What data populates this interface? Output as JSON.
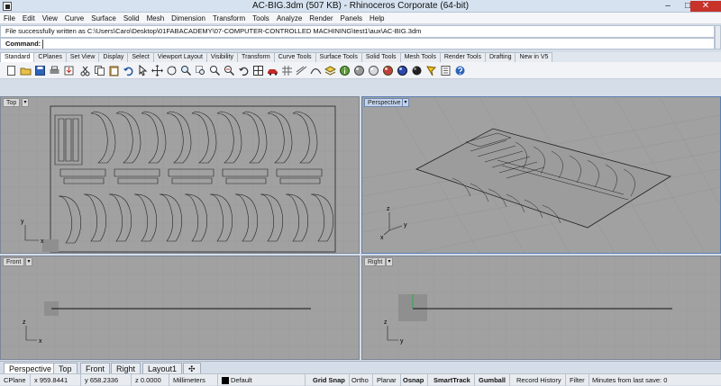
{
  "window": {
    "title": "AC-BIG.3dm (507 KB) - Rhinoceros Corporate (64-bit)",
    "min": "–",
    "max": "□",
    "close": "✕"
  },
  "menu": [
    "File",
    "Edit",
    "View",
    "Curve",
    "Surface",
    "Solid",
    "Mesh",
    "Dimension",
    "Transform",
    "Tools",
    "Analyze",
    "Render",
    "Panels",
    "Help"
  ],
  "history": "File successfully written as C:\\Users\\Caro\\Desktop\\01FABACADEMY\\07-COMPUTER-CONTROLLED MACHINING\\test1\\aux\\AC-BIG.3dm",
  "command": {
    "label": "Command:",
    "value": ""
  },
  "tabs": [
    "Standard",
    "CPlanes",
    "Set View",
    "Display",
    "Select",
    "Viewport Layout",
    "Visibility",
    "Transform",
    "Curve Tools",
    "Surface Tools",
    "Solid Tools",
    "Mesh Tools",
    "Render Tools",
    "Drafting",
    "New in V5"
  ],
  "viewports": {
    "top": "Top",
    "perspective": "Perspective",
    "front": "Front",
    "right": "Right",
    "arrow": "▾"
  },
  "axes": {
    "x": "x",
    "y": "y",
    "z": "z"
  },
  "bottom_tabs": [
    "Perspective",
    "Top",
    "Front",
    "Right",
    "Layout1",
    "✣"
  ],
  "status": {
    "cplane": "CPlane",
    "x": "x 959.8441",
    "y": "y 658.2336",
    "z": "z 0.0000",
    "units": "Millimeters",
    "layer": "Default",
    "grid_snap": "Grid Snap",
    "ortho": "Ortho",
    "planar": "Planar",
    "osnap": "Osnap",
    "smarttrack": "SmartTrack",
    "gumball": "Gumball",
    "record_history": "Record History",
    "filter": "Filter",
    "minutes": "Minutes from last save: 0"
  }
}
